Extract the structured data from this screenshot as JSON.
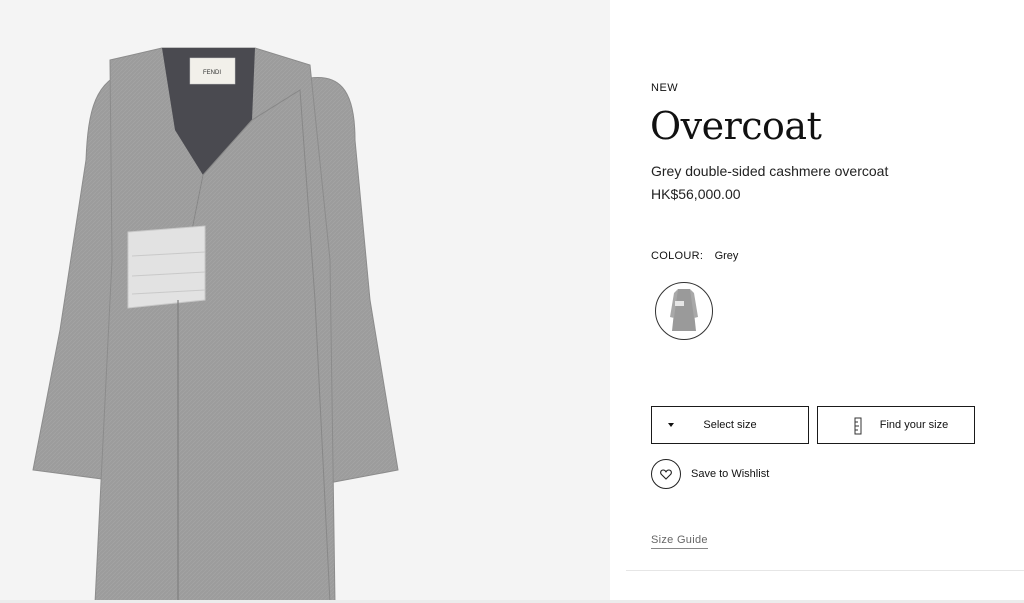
{
  "product": {
    "badge": "NEW",
    "name": "Overcoat",
    "description": "Grey double-sided cashmere overcoat",
    "price": "HK$56,000.00"
  },
  "colour": {
    "label": "COLOUR:",
    "value": "Grey",
    "swatch_color": "#9a9a9a"
  },
  "actions": {
    "select_size": "Select size",
    "find_size": "Find your size",
    "wishlist": "Save to Wishlist",
    "size_guide": "Size Guide"
  },
  "image": {
    "label_text": "FENDI",
    "coat_color": "#9c9c9c",
    "lining_color": "#4a4a50",
    "sash_color": "#e2e2e2",
    "background": "#f4f4f4"
  },
  "icons": {
    "dropdown": "caret-down-icon",
    "ruler": "ruler-icon",
    "heart": "heart-icon"
  }
}
